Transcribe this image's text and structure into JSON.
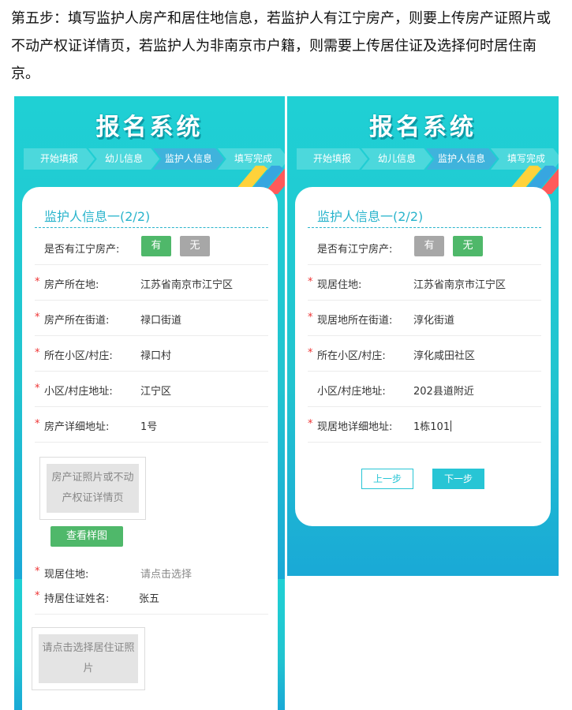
{
  "instruction": "第五步：填写监护人房产和居住地信息，若监护人有江宁房产，则要上传房产证照片或不动产权证详情页，若监护人为非南京市户籍，则需要上传居住证及选择何时居住南京。",
  "app_title": "报名系统",
  "steps": [
    "开始填报",
    "幼儿信息",
    "监护人信息",
    "填写完成"
  ],
  "active_step": "监护人信息",
  "colors": {
    "accent": "#27c5d5",
    "green": "#4fb86a",
    "required": "#e33333"
  },
  "screen_a": {
    "card_title": "监护人信息一(2/2)",
    "jiangning_question": "是否有江宁房产:",
    "yes_label": "有",
    "no_label": "无",
    "selected": "有",
    "fields": [
      {
        "label": "房产所在地:",
        "value": "江苏省南京市江宁区"
      },
      {
        "label": "房产所在街道:",
        "value": "禄口街道"
      },
      {
        "label": "所在小区/村庄:",
        "value": "禄口村"
      },
      {
        "label": "小区/村庄地址:",
        "value": "江宁区"
      },
      {
        "label": "房产详细地址:",
        "value": "1号"
      }
    ],
    "upload_text": "房产证照片或不动产权证详情页",
    "view_sample_label": "查看样图",
    "residence_label": "现居住地:",
    "residence_placeholder": "请点击选择"
  },
  "screen_b": {
    "card_title": "监护人信息一(2/2)",
    "jiangning_question": "是否有江宁房产:",
    "yes_label": "有",
    "no_label": "无",
    "selected": "无",
    "fields": [
      {
        "label": "现居住地:",
        "value": "江苏省南京市江宁区"
      },
      {
        "label": "现居地所在街道:",
        "value": "淳化街道"
      },
      {
        "label": "所在小区/村庄:",
        "value": "淳化咸田社区"
      },
      {
        "label": "小区/村庄地址:",
        "value": "202县道附近"
      },
      {
        "label": "现居地详细地址:",
        "value": "1栋101"
      }
    ],
    "prev_label": "上一步",
    "next_label": "下一步"
  },
  "screen_c": {
    "holder_label": "持居住证姓名:",
    "holder_value": "张五",
    "upload_text": "请点击选择居住证照片"
  }
}
